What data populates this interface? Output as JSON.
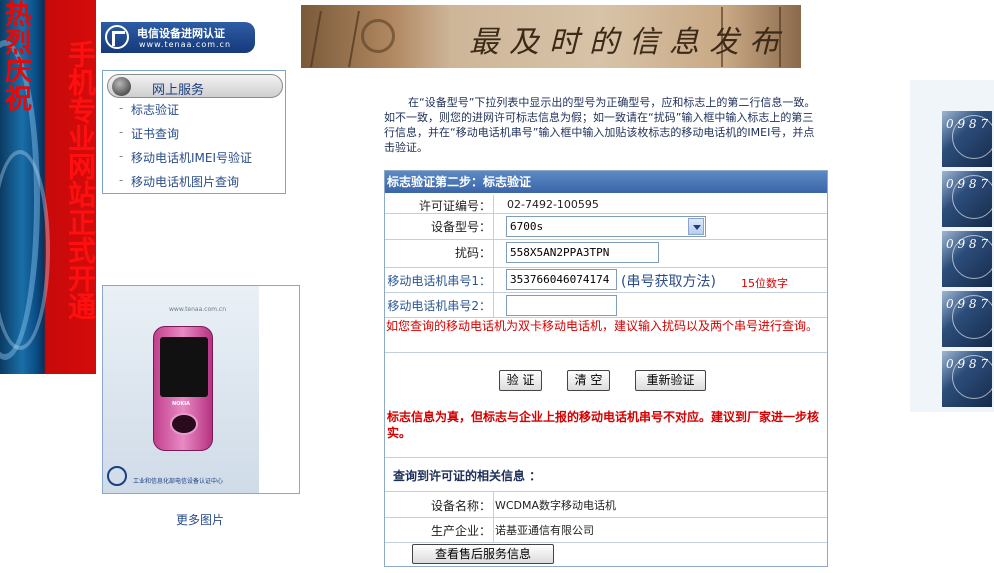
{
  "left_banner": {
    "small_text": "热烈庆祝",
    "big_text": "手机专业网站正式开通"
  },
  "logo": {
    "title": "电信设备进网认证",
    "url": "www.tenaa.com.cn"
  },
  "header": {
    "slogan": "最及时的信息发布"
  },
  "menu": {
    "title": "网上服务",
    "items": [
      "标志验证",
      "证书查询",
      "移动电话机IMEI号验证",
      "移动电话机图片查询"
    ]
  },
  "photo": {
    "watermark": "www.tenaa.com.cn",
    "phone_brand": "NOKIA",
    "caption": "工业和信息化部电信设备认证中心",
    "more_label": "更多图片"
  },
  "instructions": "在“设备型号”下拉列表中显示出的型号为正确型号，应和标志上的第二行信息一致。如不一致，则您的进网许可标志信息为假；如一致请在“扰码”输入框中输入标志上的第三行信息，并在“移动电话机串号”输入框中输入加贴该枚标志的移动电话机的IMEI号，并点击验证。",
  "form": {
    "title": "标志验证第二步：标志验证",
    "license_label": "许可证编号：",
    "license_value": "02-7492-100595",
    "model_label": "设备型号：",
    "model_selected": "6700s",
    "scramble_label": "扰码：",
    "scramble_value": "558X5AN2PPA3TPN",
    "imei1_label": "移动电话机串号1：",
    "imei1_value": "353766046074174",
    "imei_hint_link": "(串号获取方法)",
    "imei_hint_red": "15位数字",
    "imei2_label": "移动电话机串号2：",
    "imei2_value": "",
    "dual_sim_note": "如您查询的移动电话机为双卡移动电话机，建议输入扰码以及两个串号进行查询。",
    "btn_verify": "验 证",
    "btn_clear": "清 空",
    "btn_reverify": "重新验证",
    "result_message": "标志信息为真，但标志与企业上报的移动电话机串号不对应。建议到厂家进一步核实。",
    "related_title": "查询到许可证的相关信息 ：",
    "device_name_label": "设备名称：",
    "device_name_value": "WCDMA数字移动电话机",
    "manufacturer_label": "生产企业：",
    "manufacturer_value": "诺基亚通信有限公司",
    "after_sales_btn": "查看售后服务信息"
  },
  "right_tiles": {
    "digits": "0 9 8 7"
  }
}
